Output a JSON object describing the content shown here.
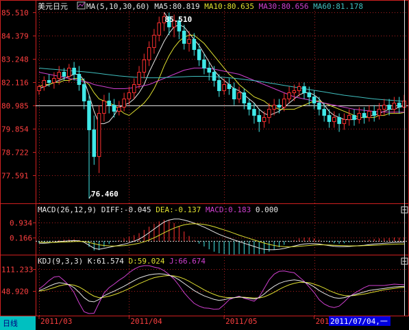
{
  "chart_data": {
    "type": "candlestick",
    "instrument": "美元日元",
    "price_panel": {
      "ma_header": [
        {
          "text": "MA(5,10,30,60)",
          "color": "#e8e8e8"
        },
        {
          "text": "MA5:80.819",
          "color": "#e8e8e8"
        },
        {
          "text": "MA10:80.635",
          "color": "#e0e030"
        },
        {
          "text": "MA30:80.656",
          "color": "#d040d0"
        },
        {
          "text": "MA60:81.178",
          "color": "#40c0c0"
        }
      ],
      "y_ticks": [
        "85.510",
        "84.379",
        "83.248",
        "82.116",
        "80.985",
        "79.854",
        "78.722",
        "77.591"
      ],
      "ylim": [
        76.46,
        85.51
      ],
      "high_label": "85.510",
      "low_label": "76.460",
      "reference_line": 80.985,
      "candles": [
        [
          81.7,
          81.9,
          81.5,
          82.0
        ],
        [
          81.9,
          82.2,
          81.7,
          82.4
        ],
        [
          82.2,
          82.1,
          81.9,
          82.5
        ],
        [
          82.1,
          82.3,
          81.8,
          82.6
        ],
        [
          82.3,
          82.6,
          82.0,
          82.9
        ],
        [
          82.6,
          82.4,
          82.2,
          82.8
        ],
        [
          82.4,
          82.8,
          82.1,
          83.0
        ],
        [
          82.8,
          82.5,
          82.2,
          83.1
        ],
        [
          82.5,
          82.0,
          81.7,
          82.9
        ],
        [
          82.0,
          81.2,
          80.8,
          82.3
        ],
        [
          81.2,
          79.8,
          76.46,
          81.5
        ],
        [
          79.8,
          78.5,
          78.1,
          80.5
        ],
        [
          78.5,
          80.6,
          77.7,
          81.0
        ],
        [
          80.6,
          81.2,
          80.2,
          81.5
        ],
        [
          81.2,
          81.0,
          80.6,
          81.6
        ],
        [
          81.0,
          80.7,
          80.4,
          81.3
        ],
        [
          80.7,
          80.9,
          80.5,
          81.2
        ],
        [
          80.9,
          81.3,
          80.7,
          81.6
        ],
        [
          81.3,
          81.6,
          81.0,
          81.9
        ],
        [
          81.6,
          82.0,
          81.3,
          82.3
        ],
        [
          82.0,
          82.6,
          81.8,
          82.9
        ],
        [
          82.6,
          83.2,
          82.3,
          83.5
        ],
        [
          83.2,
          83.8,
          82.9,
          84.1
        ],
        [
          83.8,
          84.4,
          83.5,
          84.7
        ],
        [
          84.4,
          85.0,
          84.1,
          85.3
        ],
        [
          85.0,
          85.3,
          84.6,
          85.51
        ],
        [
          85.3,
          84.8,
          84.4,
          85.5
        ],
        [
          84.8,
          85.1,
          84.3,
          85.4
        ],
        [
          85.1,
          84.6,
          84.2,
          85.3
        ],
        [
          84.6,
          84.0,
          83.7,
          84.9
        ],
        [
          84.0,
          84.2,
          83.6,
          84.6
        ],
        [
          84.2,
          83.7,
          83.4,
          84.5
        ],
        [
          83.7,
          83.2,
          82.9,
          84.0
        ],
        [
          83.2,
          82.8,
          82.5,
          83.5
        ],
        [
          82.8,
          82.6,
          82.2,
          83.1
        ],
        [
          82.6,
          82.2,
          81.9,
          82.9
        ],
        [
          82.2,
          81.7,
          81.4,
          82.5
        ],
        [
          81.7,
          82.0,
          81.5,
          82.3
        ],
        [
          82.0,
          81.8,
          81.5,
          82.3
        ],
        [
          81.8,
          81.3,
          81.0,
          82.1
        ],
        [
          81.3,
          81.6,
          81.1,
          81.9
        ],
        [
          81.6,
          81.1,
          80.8,
          81.8
        ],
        [
          81.1,
          80.8,
          80.5,
          81.3
        ],
        [
          80.8,
          80.5,
          80.1,
          81.1
        ],
        [
          80.5,
          80.2,
          79.7,
          80.8
        ],
        [
          80.2,
          80.4,
          79.9,
          80.7
        ],
        [
          80.4,
          80.8,
          80.1,
          81.1
        ],
        [
          80.8,
          81.0,
          80.5,
          81.3
        ],
        [
          81.0,
          80.9,
          80.6,
          81.3
        ],
        [
          80.9,
          81.3,
          80.7,
          81.6
        ],
        [
          81.3,
          81.6,
          81.1,
          81.9
        ],
        [
          81.6,
          81.7,
          81.2,
          82.0
        ],
        [
          81.7,
          81.9,
          81.4,
          82.1
        ],
        [
          81.9,
          81.6,
          81.3,
          82.1
        ],
        [
          81.6,
          81.4,
          81.0,
          81.9
        ],
        [
          81.4,
          81.1,
          80.8,
          81.7
        ],
        [
          81.1,
          80.8,
          80.5,
          81.4
        ],
        [
          80.8,
          80.5,
          80.2,
          81.1
        ],
        [
          80.5,
          80.2,
          79.9,
          80.8
        ],
        [
          80.2,
          80.4,
          79.9,
          80.7
        ],
        [
          80.4,
          80.1,
          79.7,
          80.6
        ],
        [
          80.1,
          80.3,
          79.8,
          80.6
        ],
        [
          80.3,
          80.5,
          80.0,
          80.8
        ],
        [
          80.5,
          80.3,
          80.0,
          80.8
        ],
        [
          80.3,
          80.6,
          80.1,
          80.9
        ],
        [
          80.6,
          80.4,
          80.1,
          80.9
        ],
        [
          80.4,
          80.7,
          80.2,
          81.0
        ],
        [
          80.7,
          80.5,
          80.2,
          81.0
        ],
        [
          80.5,
          80.8,
          80.3,
          81.1
        ],
        [
          80.8,
          81.0,
          80.5,
          81.3
        ],
        [
          81.0,
          80.8,
          80.5,
          81.3
        ],
        [
          80.8,
          81.1,
          80.6,
          81.4
        ],
        [
          81.1,
          80.9,
          80.6,
          81.4
        ],
        [
          80.9,
          81.2,
          80.7,
          81.5
        ]
      ],
      "ma_lines": [
        {
          "name": "MA5",
          "color": "#e8e8e8",
          "values": [
            81.8,
            81.9,
            82.0,
            82.1,
            82.2,
            82.3,
            82.4,
            82.5,
            82.5,
            82.2,
            81.5,
            80.7,
            80.1,
            80.1,
            80.2,
            80.5,
            80.9,
            81.0,
            81.1,
            81.3,
            81.6,
            82.0,
            82.6,
            83.1,
            83.6,
            84.1,
            84.5,
            84.8,
            84.9,
            84.8,
            84.5,
            84.2,
            83.9,
            83.5,
            83.1,
            82.7,
            82.4,
            82.2,
            82.0,
            81.8,
            81.7,
            81.5,
            81.3,
            81.1,
            80.8,
            80.6,
            80.5,
            80.6,
            80.7,
            80.9,
            81.1,
            81.3,
            81.5,
            81.6,
            81.6,
            81.5,
            81.3,
            81.0,
            80.7,
            80.5,
            80.4,
            80.3,
            80.3,
            80.3,
            80.4,
            80.4,
            80.5,
            80.5,
            80.6,
            80.7,
            80.8,
            80.8,
            80.9,
            80.95
          ]
        },
        {
          "name": "MA10",
          "color": "#e0e030",
          "values": [
            81.9,
            82.0,
            82.0,
            82.1,
            82.1,
            82.2,
            82.2,
            82.3,
            82.3,
            82.2,
            82.0,
            81.6,
            81.3,
            81.2,
            81.1,
            81.0,
            80.8,
            80.6,
            80.5,
            80.7,
            80.9,
            81.1,
            81.4,
            81.8,
            82.3,
            82.9,
            83.4,
            83.8,
            84.1,
            84.3,
            84.4,
            84.4,
            84.2,
            84.0,
            83.7,
            83.4,
            83.1,
            82.8,
            82.5,
            82.3,
            82.0,
            81.8,
            81.6,
            81.4,
            81.3,
            81.2,
            81.0,
            80.9,
            80.8,
            80.8,
            80.8,
            80.8,
            80.9,
            81.0,
            81.1,
            81.2,
            81.2,
            81.1,
            81.0,
            80.9,
            80.8,
            80.7,
            80.6,
            80.5,
            80.4,
            80.4,
            80.4,
            80.4,
            80.5,
            80.5,
            80.6,
            80.6,
            80.6,
            80.64
          ]
        },
        {
          "name": "MA30",
          "color": "#d040d0",
          "values": [
            82.6,
            82.55,
            82.5,
            82.45,
            82.4,
            82.35,
            82.3,
            82.25,
            82.2,
            82.15,
            82.1,
            82.0,
            81.95,
            81.9,
            81.85,
            81.8,
            81.8,
            81.8,
            81.82,
            81.85,
            81.9,
            81.95,
            82.0,
            82.1,
            82.2,
            82.3,
            82.4,
            82.5,
            82.6,
            82.7,
            82.75,
            82.8,
            82.8,
            82.8,
            82.78,
            82.75,
            82.7,
            82.65,
            82.6,
            82.55,
            82.5,
            82.4,
            82.3,
            82.2,
            82.1,
            82.0,
            81.9,
            81.8,
            81.7,
            81.6,
            81.5,
            81.4,
            81.35,
            81.3,
            81.25,
            81.2,
            81.15,
            81.1,
            81.05,
            81.0,
            80.95,
            80.9,
            80.85,
            80.8,
            80.78,
            80.75,
            80.72,
            80.7,
            80.68,
            80.67,
            80.66,
            80.66,
            80.66,
            80.656
          ]
        },
        {
          "name": "MA60",
          "color": "#40c0c0",
          "values": [
            82.8,
            82.78,
            82.76,
            82.74,
            82.72,
            82.7,
            82.68,
            82.66,
            82.64,
            82.62,
            82.6,
            82.57,
            82.54,
            82.51,
            82.48,
            82.45,
            82.42,
            82.4,
            82.38,
            82.36,
            82.35,
            82.34,
            82.33,
            82.33,
            82.33,
            82.34,
            82.35,
            82.36,
            82.37,
            82.38,
            82.39,
            82.4,
            82.4,
            82.4,
            82.39,
            82.38,
            82.37,
            82.35,
            82.33,
            82.31,
            82.28,
            82.25,
            82.22,
            82.19,
            82.16,
            82.12,
            82.08,
            82.04,
            82.0,
            81.96,
            81.92,
            81.88,
            81.84,
            81.8,
            81.76,
            81.72,
            81.68,
            81.64,
            81.6,
            81.56,
            81.52,
            81.48,
            81.45,
            81.42,
            81.39,
            81.36,
            81.33,
            81.3,
            81.28,
            81.26,
            81.24,
            81.22,
            81.2,
            81.178
          ]
        }
      ]
    },
    "macd_panel": {
      "header": [
        {
          "text": "MACD(26,12,9)",
          "color": "#e8e8e8"
        },
        {
          "text": "DIFF:-0.045",
          "color": "#e8e8e8"
        },
        {
          "text": "DEA:-0.137",
          "color": "#e0e030"
        },
        {
          "text": "MACD:0.183",
          "color": "#d040d0"
        },
        {
          "text": "0.000",
          "color": "#e8e8e8"
        }
      ],
      "y_ticks": [
        "0.934",
        "0.166"
      ],
      "ylim": [
        -0.6,
        1.3
      ],
      "diff": [
        -0.1,
        -0.1,
        -0.08,
        -0.05,
        -0.02,
        0.0,
        0.02,
        0.03,
        0.02,
        -0.05,
        -0.2,
        -0.35,
        -0.4,
        -0.35,
        -0.3,
        -0.25,
        -0.2,
        -0.15,
        -0.08,
        0.0,
        0.1,
        0.25,
        0.42,
        0.6,
        0.78,
        0.95,
        1.05,
        1.1,
        1.1,
        1.05,
        0.98,
        0.9,
        0.8,
        0.7,
        0.58,
        0.46,
        0.34,
        0.24,
        0.15,
        0.06,
        -0.02,
        -0.1,
        -0.18,
        -0.26,
        -0.34,
        -0.4,
        -0.42,
        -0.42,
        -0.4,
        -0.36,
        -0.3,
        -0.24,
        -0.18,
        -0.14,
        -0.12,
        -0.12,
        -0.14,
        -0.18,
        -0.22,
        -0.25,
        -0.27,
        -0.27,
        -0.26,
        -0.24,
        -0.22,
        -0.2,
        -0.17,
        -0.14,
        -0.12,
        -0.1,
        -0.08,
        -0.06,
        -0.05,
        -0.045
      ],
      "dea": [
        -0.05,
        -0.06,
        -0.06,
        -0.06,
        -0.05,
        -0.04,
        -0.03,
        -0.02,
        -0.01,
        -0.02,
        -0.06,
        -0.12,
        -0.18,
        -0.21,
        -0.23,
        -0.24,
        -0.23,
        -0.22,
        -0.19,
        -0.15,
        -0.1,
        -0.03,
        0.06,
        0.17,
        0.29,
        0.42,
        0.54,
        0.65,
        0.74,
        0.81,
        0.85,
        0.87,
        0.86,
        0.83,
        0.78,
        0.72,
        0.64,
        0.56,
        0.48,
        0.39,
        0.3,
        0.22,
        0.14,
        0.06,
        -0.02,
        -0.09,
        -0.16,
        -0.21,
        -0.25,
        -0.27,
        -0.28,
        -0.27,
        -0.25,
        -0.23,
        -0.21,
        -0.19,
        -0.18,
        -0.18,
        -0.19,
        -0.2,
        -0.21,
        -0.22,
        -0.23,
        -0.23,
        -0.23,
        -0.22,
        -0.21,
        -0.2,
        -0.19,
        -0.17,
        -0.16,
        -0.15,
        -0.14,
        -0.137
      ]
    },
    "kdj_panel": {
      "header": [
        {
          "text": "KDJ(9,3,3)",
          "color": "#e8e8e8"
        },
        {
          "text": "K:61.574",
          "color": "#e8e8e8"
        },
        {
          "text": "D:59.024",
          "color": "#e0e030"
        },
        {
          "text": "J:66.674",
          "color": "#d040d0"
        }
      ],
      "y_ticks": [
        "111.233",
        "48.920"
      ],
      "ylim": [
        -15,
        120
      ],
      "k": [
        50,
        55,
        62,
        68,
        72,
        70,
        66,
        58,
        45,
        30,
        20,
        18,
        25,
        35,
        42,
        48,
        55,
        62,
        70,
        78,
        85,
        90,
        94,
        96,
        97,
        96,
        93,
        88,
        80,
        70,
        60,
        50,
        42,
        35,
        30,
        25,
        22,
        24,
        28,
        30,
        32,
        30,
        28,
        26,
        30,
        40,
        52,
        62,
        70,
        75,
        78,
        80,
        78,
        74,
        68,
        60,
        50,
        42,
        35,
        30,
        28,
        30,
        34,
        38,
        42,
        46,
        50,
        52,
        54,
        56,
        58,
        60,
        61,
        61.574
      ],
      "d": [
        48,
        50,
        54,
        58,
        63,
        66,
        67,
        65,
        60,
        52,
        42,
        34,
        30,
        31,
        34,
        38,
        43,
        49,
        55,
        62,
        69,
        75,
        81,
        86,
        89,
        91,
        92,
        91,
        88,
        83,
        76,
        68,
        60,
        52,
        45,
        39,
        34,
        31,
        30,
        30,
        31,
        31,
        30,
        29,
        29,
        32,
        38,
        45,
        53,
        60,
        66,
        70,
        73,
        73,
        72,
        68,
        63,
        57,
        50,
        44,
        39,
        36,
        35,
        36,
        38,
        40,
        43,
        46,
        49,
        52,
        54,
        56,
        58,
        59.024
      ],
      "j": [
        54,
        65,
        78,
        88,
        90,
        78,
        64,
        44,
        15,
        -10,
        -15,
        -14,
        15,
        43,
        58,
        68,
        79,
        88,
        100,
        110,
        117,
        120,
        120,
        116,
        113,
        106,
        95,
        82,
        64,
        44,
        28,
        14,
        6,
        1,
        0,
        -3,
        -2,
        10,
        24,
        30,
        34,
        28,
        24,
        20,
        32,
        56,
        80,
        96,
        104,
        105,
        102,
        100,
        88,
        76,
        60,
        44,
        24,
        12,
        5,
        2,
        6,
        18,
        32,
        42,
        50,
        58,
        64,
        64,
        64,
        64,
        66,
        68,
        67,
        66.674
      ]
    },
    "x_ticks": [
      {
        "index": 0,
        "label": "2011/03"
      },
      {
        "index": 18,
        "label": "2011/04"
      },
      {
        "index": 37,
        "label": "2011/05"
      },
      {
        "index": 55,
        "label": "2011/06"
      }
    ],
    "cursor_index": 73,
    "cursor_date_label": "2011/07/04,一",
    "period_label": "日线",
    "colors": {
      "up": "#ff3030",
      "down": "#40e8e8",
      "axis": "#d02020",
      "grid": "#b02020",
      "label": "#ff4040"
    }
  }
}
